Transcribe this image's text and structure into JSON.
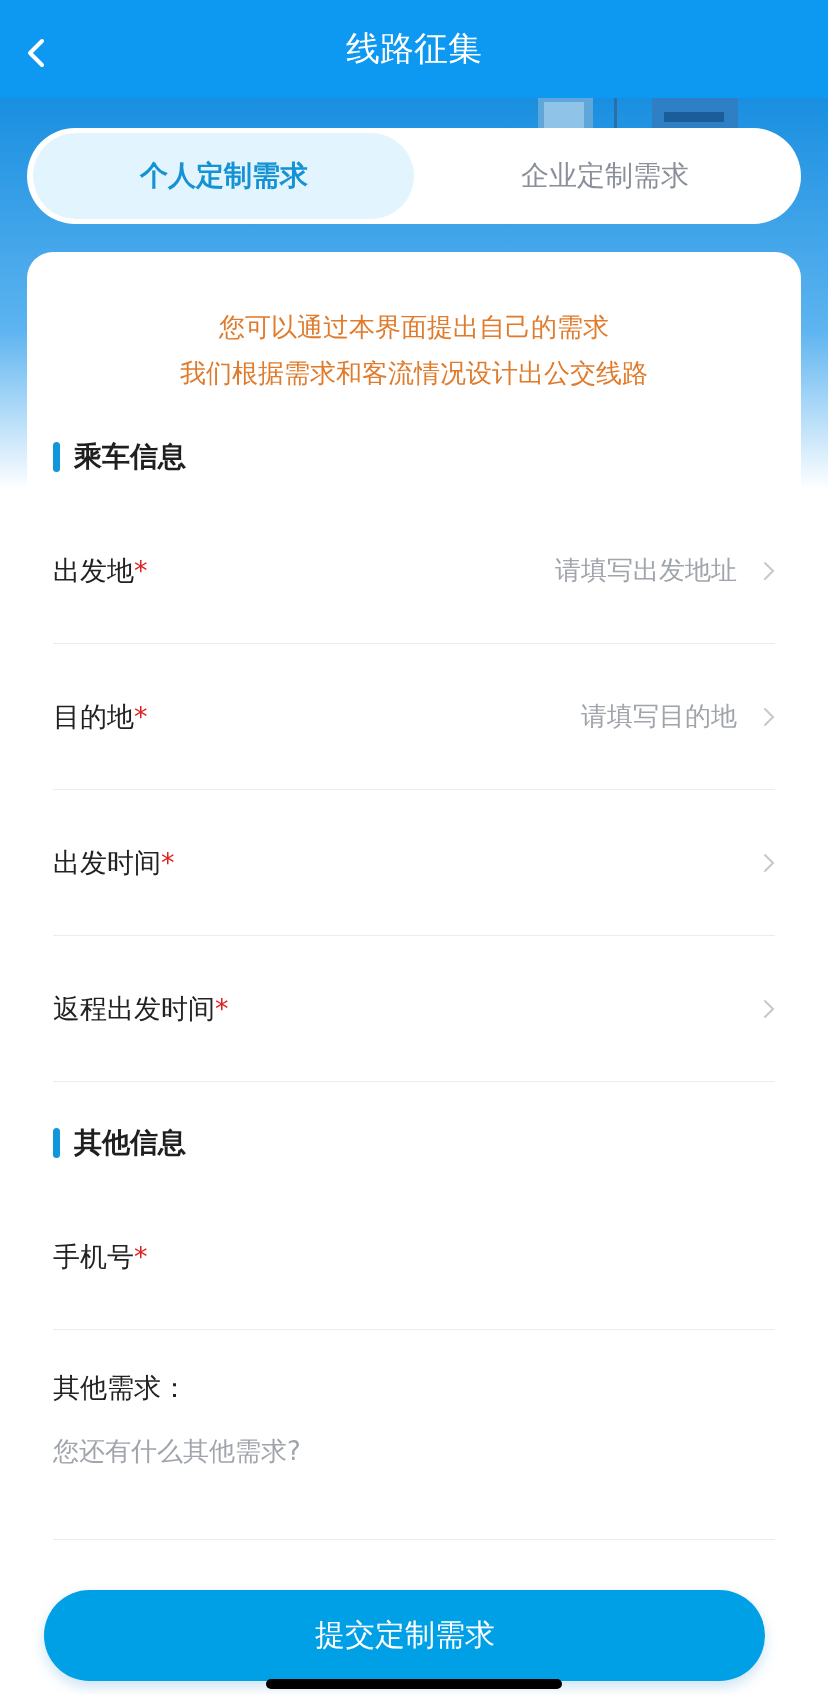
{
  "header": {
    "title": "线路征集"
  },
  "tabs": [
    {
      "label": "个人定制需求",
      "selected": true
    },
    {
      "label": "企业定制需求",
      "selected": false
    }
  ],
  "notice": [
    "您可以通过本界面提出自己的需求",
    "我们根据需求和客流情况设计出公交线路"
  ],
  "sections": [
    {
      "title": "乘车信息",
      "fields": [
        {
          "kind": "select",
          "label": "出发地",
          "required_mark": "*",
          "placeholder": "请填写出发地址"
        },
        {
          "kind": "select",
          "label": "目的地",
          "required_mark": "*",
          "placeholder": "请填写目的地"
        },
        {
          "kind": "select",
          "label": "出发时间",
          "required_mark": "*"
        },
        {
          "kind": "select",
          "label": "返程出发时间",
          "required_mark": "*"
        }
      ]
    },
    {
      "title": "其他信息",
      "fields": [
        {
          "kind": "input",
          "label": "手机号",
          "required_mark": "*"
        },
        {
          "kind": "textarea",
          "label": "其他需求：",
          "placeholder": "您还有什么其他需求?"
        }
      ]
    }
  ],
  "submit_button": "提交定制需求"
}
